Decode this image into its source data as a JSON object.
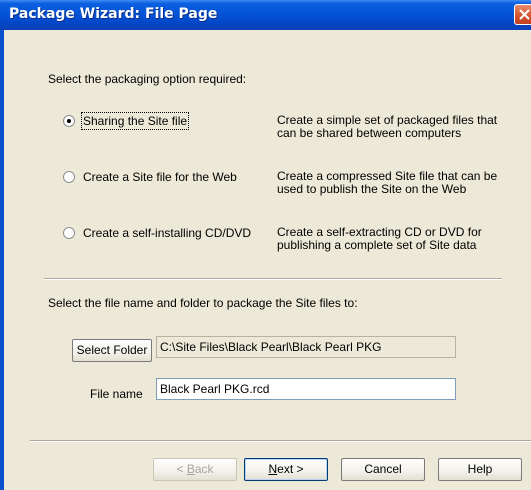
{
  "window": {
    "title": "Package Wizard: File Page"
  },
  "packaging": {
    "prompt": "Select the packaging option required:",
    "options": [
      {
        "label": "Sharing the Site file",
        "selected": true,
        "desc_line1": "Create a simple set of packaged files that",
        "desc_line2": "can be shared between computers"
      },
      {
        "label": "Create a Site file for the Web",
        "selected": false,
        "desc_line1": "Create a compressed Site file that can be",
        "desc_line2": "used to publish the Site on the Web"
      },
      {
        "label": "Create a self-installing CD/DVD",
        "selected": false,
        "desc_line1": "Create a self-extracting CD or DVD for",
        "desc_line2": "publishing a complete set of Site data"
      }
    ]
  },
  "location": {
    "prompt": "Select the file name and folder to package the Site files to:",
    "select_folder_label": "Select Folder",
    "folder_path": "C:\\Site Files\\Black Pearl\\Black Pearl PKG",
    "file_name_label": "File name",
    "file_name_value": "Black Pearl PKG.rcd"
  },
  "buttons": {
    "back_prefix": "< ",
    "back_mnemonic": "B",
    "back_rest": "ack",
    "next_mnemonic": "N",
    "next_rest": "ext >",
    "cancel": "Cancel",
    "help": "Help"
  },
  "colors": {
    "titlebar": "#0554d8",
    "dialog_bg": "#ece9d8",
    "close_button": "#d5512d"
  }
}
